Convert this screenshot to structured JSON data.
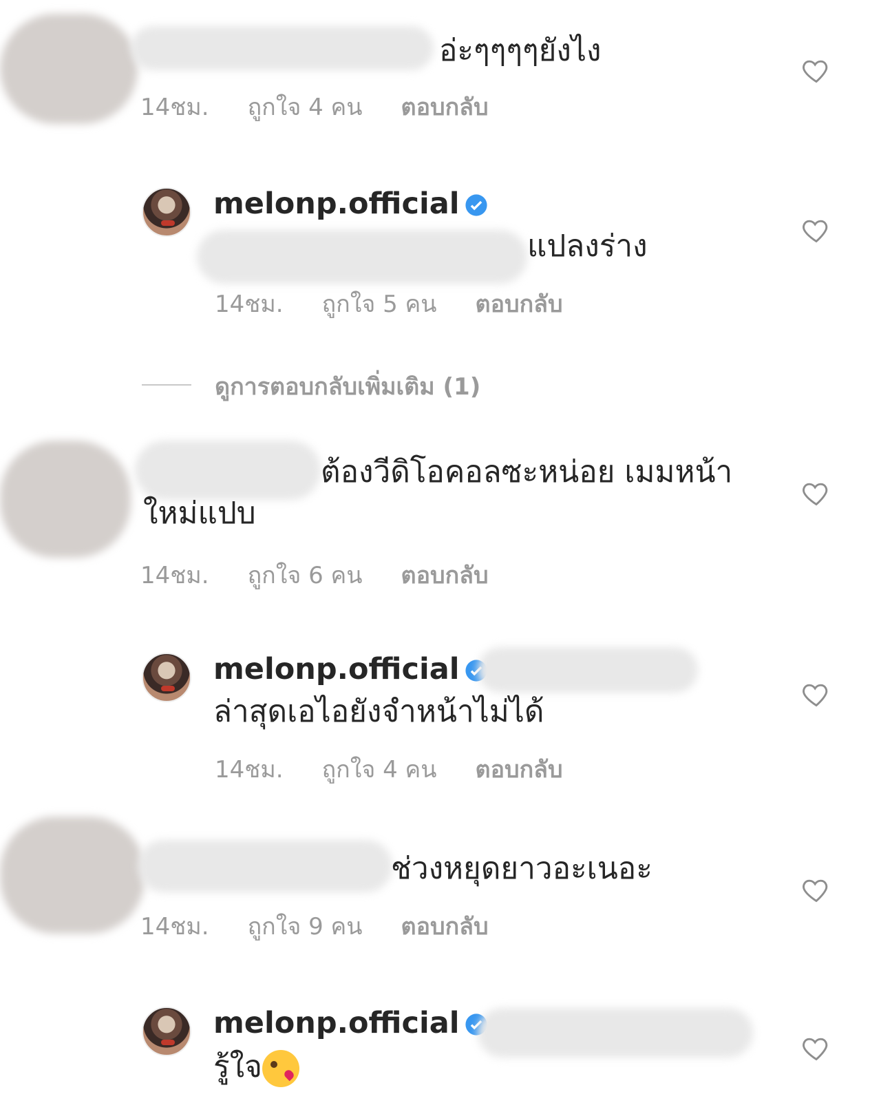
{
  "comments": [
    {
      "text": "อ่ะๆๆๆๆยังไง",
      "time": "14ชม.",
      "likes": "ถูกใจ 4 คน",
      "reply": "ตอบกลับ"
    },
    {
      "username": "melonp.official",
      "text": "แปลงร่าง",
      "time": "14ชม.",
      "likes": "ถูกใจ 5 คน",
      "reply": "ตอบกลับ"
    },
    {
      "text_line1": "ต้องวีดิโอคอลซะหน่อย เมมหน้า",
      "text_line2": "ใหม่แปบ",
      "time": "14ชม.",
      "likes": "ถูกใจ 6 คน",
      "reply": "ตอบกลับ"
    },
    {
      "username": "melonp.official",
      "text": "ล่าสุดเอไอยังจำหน้าไม่ได้",
      "time": "14ชม.",
      "likes": "ถูกใจ 4 คน",
      "reply": "ตอบกลับ"
    },
    {
      "text": "ช่วงหยุดยาวอะเนอะ",
      "time": "14ชม.",
      "likes": "ถูกใจ 9 คน",
      "reply": "ตอบกลับ"
    },
    {
      "username": "melonp.official",
      "text": "รู้ใจ"
    }
  ],
  "more_replies": "ดูการตอบกลับเพิ่มเติม (1)",
  "colors": {
    "text": "#262626",
    "meta": "#9a9a9a",
    "verified": "#3897f0"
  },
  "icons": {
    "like": "heart-outline-icon",
    "verified": "verified-badge-icon"
  }
}
